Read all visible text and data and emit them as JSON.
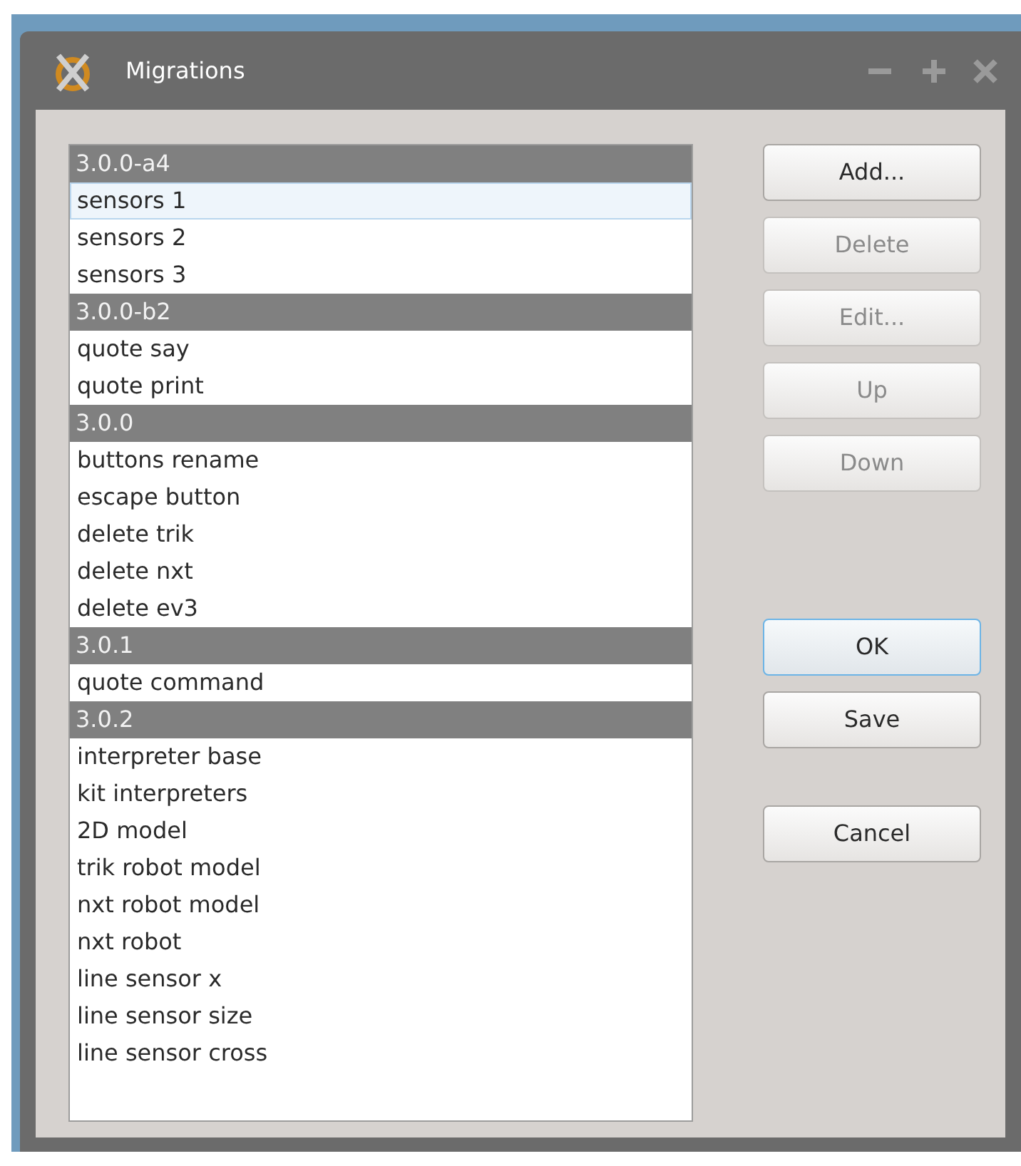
{
  "window": {
    "title": "Migrations"
  },
  "list": [
    {
      "kind": "group",
      "label": "3.0.0-a4"
    },
    {
      "kind": "item",
      "label": "sensors 1",
      "selected": true
    },
    {
      "kind": "item",
      "label": "sensors 2",
      "selected": false
    },
    {
      "kind": "item",
      "label": "sensors 3",
      "selected": false
    },
    {
      "kind": "group",
      "label": "3.0.0-b2"
    },
    {
      "kind": "item",
      "label": "quote say",
      "selected": false
    },
    {
      "kind": "item",
      "label": "quote print",
      "selected": false
    },
    {
      "kind": "group",
      "label": "3.0.0"
    },
    {
      "kind": "item",
      "label": "buttons rename",
      "selected": false
    },
    {
      "kind": "item",
      "label": "escape button",
      "selected": false
    },
    {
      "kind": "item",
      "label": "delete trik",
      "selected": false
    },
    {
      "kind": "item",
      "label": "delete nxt",
      "selected": false
    },
    {
      "kind": "item",
      "label": "delete ev3",
      "selected": false
    },
    {
      "kind": "group",
      "label": "3.0.1"
    },
    {
      "kind": "item",
      "label": "quote command",
      "selected": false
    },
    {
      "kind": "group",
      "label": "3.0.2"
    },
    {
      "kind": "item",
      "label": "interpreter base",
      "selected": false
    },
    {
      "kind": "item",
      "label": "kit interpreters",
      "selected": false
    },
    {
      "kind": "item",
      "label": "2D model",
      "selected": false
    },
    {
      "kind": "item",
      "label": "trik robot model",
      "selected": false
    },
    {
      "kind": "item",
      "label": "nxt robot model",
      "selected": false
    },
    {
      "kind": "item",
      "label": "nxt robot",
      "selected": false
    },
    {
      "kind": "item",
      "label": "line sensor x",
      "selected": false
    },
    {
      "kind": "item",
      "label": "line sensor size",
      "selected": false
    },
    {
      "kind": "item",
      "label": "line sensor cross",
      "selected": false
    }
  ],
  "button_groups": [
    [
      {
        "label": "Add...",
        "disabled": false,
        "default": false
      },
      {
        "label": "Delete",
        "disabled": true,
        "default": false
      },
      {
        "label": "Edit...",
        "disabled": true,
        "default": false
      },
      {
        "label": "Up",
        "disabled": true,
        "default": false
      },
      {
        "label": "Down",
        "disabled": true,
        "default": false
      }
    ],
    [
      {
        "label": "OK",
        "disabled": false,
        "default": true
      },
      {
        "label": "Save",
        "disabled": false,
        "default": false
      }
    ],
    [
      {
        "label": "Cancel",
        "disabled": false,
        "default": false
      }
    ]
  ]
}
